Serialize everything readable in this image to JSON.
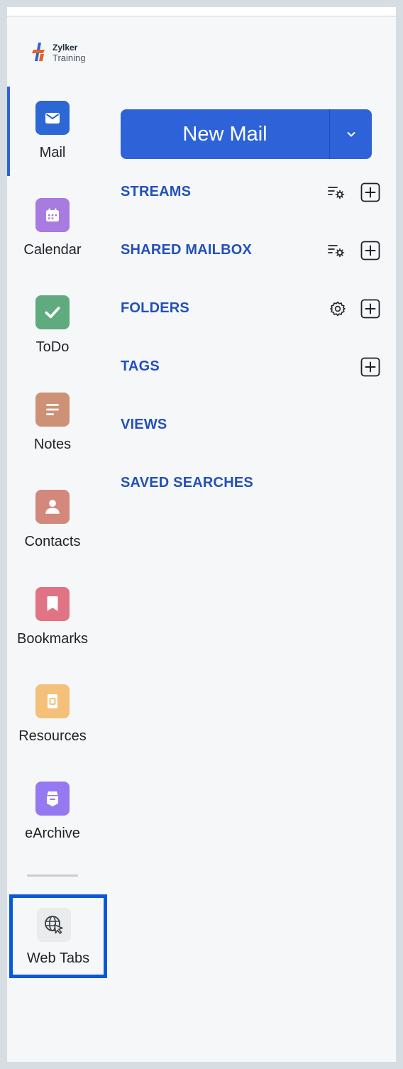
{
  "brand": {
    "line1": "Zylker",
    "line2": "Training"
  },
  "apps": [
    {
      "label": "Mail",
      "icon": "mail-icon",
      "color": "#2d67d6"
    },
    {
      "label": "Calendar",
      "icon": "calendar-icon",
      "color": "#a77be0"
    },
    {
      "label": "ToDo",
      "icon": "checkmark-icon",
      "color": "#5fab7d"
    },
    {
      "label": "Notes",
      "icon": "notes-icon",
      "color": "#cd9176"
    },
    {
      "label": "Contacts",
      "icon": "person-icon",
      "color": "#d2897c"
    },
    {
      "label": "Bookmarks",
      "icon": "bookmark-icon",
      "color": "#e17484"
    },
    {
      "label": "Resources",
      "icon": "resource-icon",
      "color": "#f4c07a"
    },
    {
      "label": "eArchive",
      "icon": "archive-icon",
      "color": "#9579f0"
    }
  ],
  "web_tabs": {
    "label": "Web Tabs",
    "icon": "globe-cursor-icon"
  },
  "compose": {
    "label": "New Mail"
  },
  "sections": [
    {
      "label": "STREAMS"
    },
    {
      "label": "SHARED MAILBOX"
    },
    {
      "label": "FOLDERS"
    },
    {
      "label": "TAGS"
    },
    {
      "label": "VIEWS"
    },
    {
      "label": "SAVED SEARCHES"
    }
  ],
  "colors": {
    "accent": "#2d62d9",
    "section_text": "#2450b8",
    "highlight_border": "#0a58d6"
  }
}
